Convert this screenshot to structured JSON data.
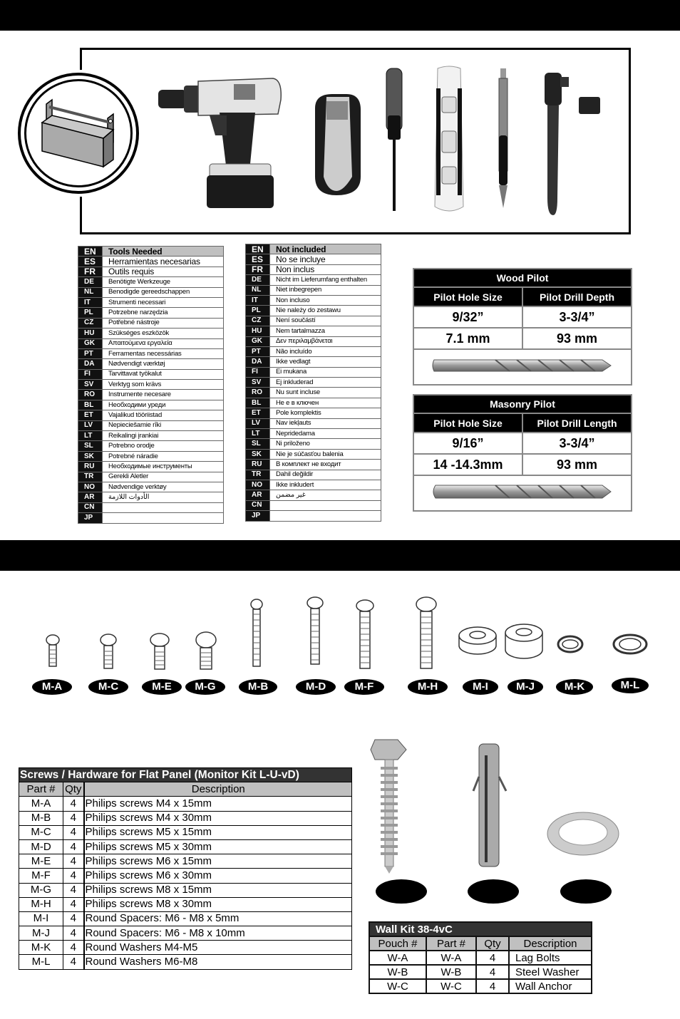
{
  "tools_section": {
    "tools": [
      "Cordless drill",
      "Stud finder",
      "Screwdriver",
      "Level",
      "Pencil",
      "Socket wrench"
    ],
    "tools_needed": {
      "rows": [
        {
          "code": "EN",
          "text": "Tools Needed"
        },
        {
          "code": "ES",
          "text": "Herramientas necesarias"
        },
        {
          "code": "FR",
          "text": "Outils requis"
        },
        {
          "code": "DE",
          "text": "Benötigte Werkzeuge"
        },
        {
          "code": "NL",
          "text": "Benodigde gereedschappen"
        },
        {
          "code": "IT",
          "text": "Strumenti necessari"
        },
        {
          "code": "PL",
          "text": "Potrzebne narzędzia"
        },
        {
          "code": "CZ",
          "text": "Potřebné nástroje"
        },
        {
          "code": "HU",
          "text": "Szükséges eszközök"
        },
        {
          "code": "GK",
          "text": "Απαιτούμενα εργαλεία"
        },
        {
          "code": "PT",
          "text": "Ferramentas necessárias"
        },
        {
          "code": "DA",
          "text": "Nødvendigt værktøj"
        },
        {
          "code": "FI",
          "text": "Tarvittavat työkalut"
        },
        {
          "code": "SV",
          "text": "Verktyg som krävs"
        },
        {
          "code": "RO",
          "text": "Instrumente necesare"
        },
        {
          "code": "BL",
          "text": "Необходими уреди"
        },
        {
          "code": "ET",
          "text": "Vajalikud tööriistad"
        },
        {
          "code": "LV",
          "text": "Nepieciešamie rīki"
        },
        {
          "code": "LT",
          "text": "Reikalingi įrankiai"
        },
        {
          "code": "SL",
          "text": "Potrebno orodje"
        },
        {
          "code": "SK",
          "text": "Potrebné náradie"
        },
        {
          "code": "RU",
          "text": "Необходимые инструменты"
        },
        {
          "code": "TR",
          "text": "Gerekli Aletler"
        },
        {
          "code": "NO",
          "text": "Nødvendige verktøy"
        },
        {
          "code": "AR",
          "text": "الأدوات اللازمة"
        },
        {
          "code": "CN",
          "text": ""
        },
        {
          "code": "JP",
          "text": ""
        }
      ]
    },
    "not_included": {
      "rows": [
        {
          "code": "EN",
          "text": "Not included"
        },
        {
          "code": "ES",
          "text": "No se incluye"
        },
        {
          "code": "FR",
          "text": "Non inclus"
        },
        {
          "code": "DE",
          "text": "Nicht im Lieferumfang enthalten"
        },
        {
          "code": "NL",
          "text": "Niet inbegrepen"
        },
        {
          "code": "IT",
          "text": "Non incluso"
        },
        {
          "code": "PL",
          "text": "Nie należy do zestawu"
        },
        {
          "code": "CZ",
          "text": "Není součástí"
        },
        {
          "code": "HU",
          "text": "Nem tartalmazza"
        },
        {
          "code": "GK",
          "text": "Δεν περιλαμβάνεται"
        },
        {
          "code": "PT",
          "text": "Não incluído"
        },
        {
          "code": "DA",
          "text": "Ikke vedlagt"
        },
        {
          "code": "FI",
          "text": "Ei mukana"
        },
        {
          "code": "SV",
          "text": "Ej inkluderad"
        },
        {
          "code": "RO",
          "text": "Nu sunt incluse"
        },
        {
          "code": "BL",
          "text": "Не е в ключен"
        },
        {
          "code": "ET",
          "text": "Pole komplektis"
        },
        {
          "code": "LV",
          "text": "Nav iekļauts"
        },
        {
          "code": "LT",
          "text": "Nepridedama"
        },
        {
          "code": "SL",
          "text": "Ni priloženo"
        },
        {
          "code": "SK",
          "text": "Nie je súčasťou balenia"
        },
        {
          "code": "RU",
          "text": "В комплект не входит"
        },
        {
          "code": "TR",
          "text": "Dahil değildir"
        },
        {
          "code": "NO",
          "text": "Ikke inkludert"
        },
        {
          "code": "AR",
          "text": "غير مضمن"
        },
        {
          "code": "CN",
          "text": ""
        },
        {
          "code": "JP",
          "text": ""
        }
      ]
    },
    "wood_pilot": {
      "title": "Wood Pilot",
      "col1": "Pilot Hole Size",
      "col2": "Pilot Drill Depth",
      "rows": [
        [
          "9/32”",
          "3-3/4”"
        ],
        [
          "7.1 mm",
          "93 mm"
        ]
      ]
    },
    "masonry_pilot": {
      "title": "Masonry Pilot",
      "col1": "Pilot Hole Size",
      "col2": "Pilot Drill Length",
      "rows": [
        [
          "9/16”",
          "3-3/4”"
        ],
        [
          "14 -14.3mm",
          "93 mm"
        ]
      ]
    }
  },
  "hardware_labels": [
    "M-A",
    "M-C",
    "M-E",
    "M-G",
    "M-B",
    "M-D",
    "M-F",
    "M-H",
    "M-I",
    "M-J",
    "M-K",
    "M-L"
  ],
  "screws_table": {
    "title": "Screws / Hardware for Flat Panel (Monitor Kit L-U-vD)",
    "headers": [
      "Part #",
      "Qty",
      "Description"
    ],
    "rows": [
      [
        "M-A",
        "4",
        "Philips screws M4 x 15mm"
      ],
      [
        "M-B",
        "4",
        "Philips screws M4 x 30mm"
      ],
      [
        "M-C",
        "4",
        "Philips screws M5 x 15mm"
      ],
      [
        "M-D",
        "4",
        "Philips screws M5 x 30mm"
      ],
      [
        "M-E",
        "4",
        "Philips screws M6 x 15mm"
      ],
      [
        "M-F",
        "4",
        "Philips screws M6 x 30mm"
      ],
      [
        "M-G",
        "4",
        "Philips screws M8 x 15mm"
      ],
      [
        "M-H",
        "4",
        "Philips screws M8 x 30mm"
      ],
      [
        "M-I",
        "4",
        "Round Spacers:  M6 - M8 x 5mm"
      ],
      [
        "M-J",
        "4",
        "Round Spacers:  M6 - M8 x 10mm"
      ],
      [
        "M-K",
        "4",
        "Round Washers M4-M5"
      ],
      [
        "M-L",
        "4",
        "Round Washers M6-M8"
      ]
    ]
  },
  "wall_kit": {
    "title": "Wall Kit 38-4vC",
    "headers": [
      "Pouch #",
      "Part #",
      "Qty",
      "Description"
    ],
    "rows": [
      [
        "W-A",
        "W-A",
        "4",
        "Lag Bolts"
      ],
      [
        "W-B",
        "W-B",
        "4",
        "Steel Washer"
      ],
      [
        "W-C",
        "W-C",
        "4",
        "Wall Anchor"
      ]
    ]
  }
}
